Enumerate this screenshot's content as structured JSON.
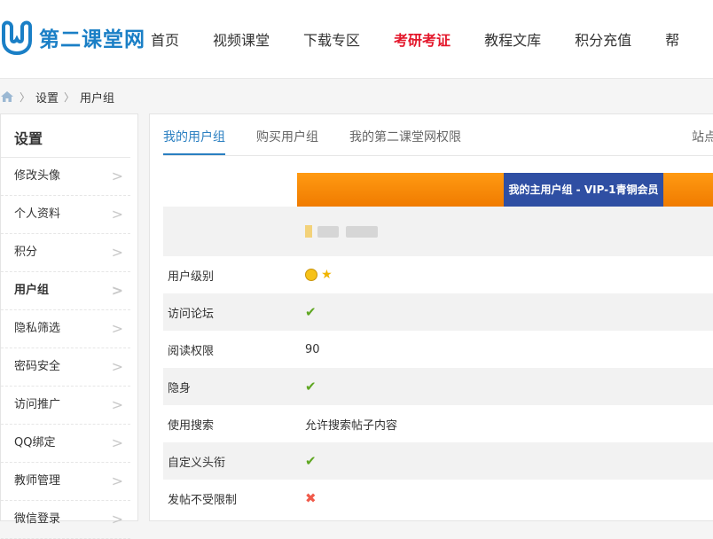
{
  "site": {
    "name": "第二课堂网"
  },
  "nav": [
    "首页",
    "视频课堂",
    "下载专区",
    "考研考证",
    "教程文库",
    "积分充值",
    "帮"
  ],
  "nav_active_index": 3,
  "breadcrumb": [
    "设置",
    "用户组"
  ],
  "sidebar": {
    "title": "设置",
    "items": [
      "修改头像",
      "个人资料",
      "积分",
      "用户组",
      "隐私筛选",
      "密码安全",
      "访问推广",
      "QQ绑定",
      "教师管理",
      "微信登录"
    ],
    "active_index": 3
  },
  "tabs": [
    "我的用户组",
    "购买用户组",
    "我的第二课堂网权限",
    "站点"
  ],
  "group_header": "我的主用户组 - VIP-1青铜会员",
  "rows": [
    {
      "label": "用户级别",
      "type": "icons"
    },
    {
      "label": "访问论坛",
      "type": "check"
    },
    {
      "label": "阅读权限",
      "type": "text",
      "value": "90"
    },
    {
      "label": "隐身",
      "type": "check"
    },
    {
      "label": "使用搜索",
      "type": "text",
      "value": "允许搜索帖子内容"
    },
    {
      "label": "自定义头衔",
      "type": "check"
    },
    {
      "label": "发帖不受限制",
      "type": "cross"
    }
  ],
  "colors": {
    "accent": "#2a7fc1",
    "nav_active": "#e4172b",
    "band": "#f07b00",
    "band_title_bg": "#2f4fa3",
    "check": "#5fa722",
    "cross": "#f05a4a"
  }
}
